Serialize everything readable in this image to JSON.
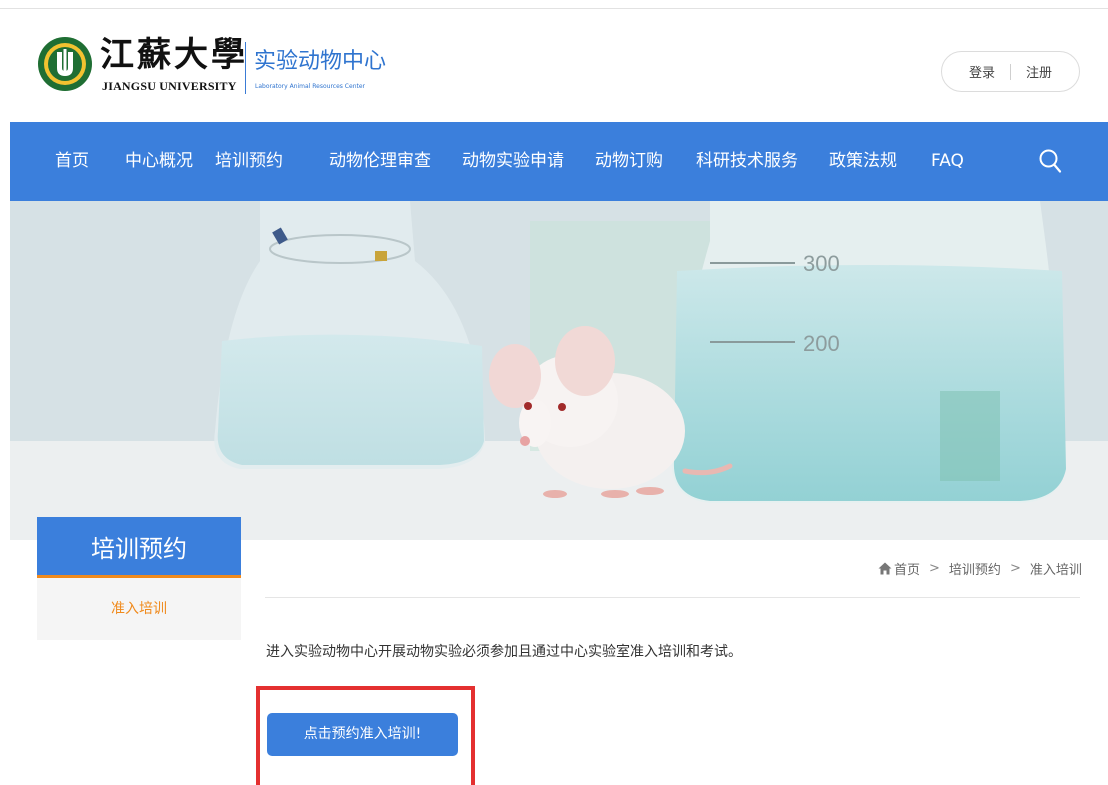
{
  "header": {
    "logo_cn": "江蘇大學",
    "logo_en": "JIANGSU UNIVERSITY",
    "center_cn": "实验动物中心",
    "center_en": "Laboratory Animal Resources Center",
    "login": "登录",
    "register": "注册"
  },
  "nav": {
    "items": [
      {
        "label": "首页"
      },
      {
        "label": "中心概况"
      },
      {
        "label": "培训预约"
      },
      {
        "label": "动物伦理审查"
      },
      {
        "label": "动物实验申请"
      },
      {
        "label": "动物订购"
      },
      {
        "label": "科研技术服务"
      },
      {
        "label": "政策法规"
      },
      {
        "label": "FAQ"
      }
    ],
    "search_icon": "search-icon"
  },
  "banner": {
    "flask_marks": [
      "300",
      "200"
    ]
  },
  "sidebar": {
    "title": "培训预约",
    "items": [
      {
        "label": "准入培训"
      }
    ]
  },
  "breadcrumb": {
    "home": "首页",
    "level1": "培训预约",
    "level2": "准入培训",
    "separator": ">"
  },
  "content": {
    "notice": "进入实验动物中心开展动物实验必须参加且通过中心实验室准入培训和考试。",
    "button": "点击预约准入培训!"
  },
  "colors": {
    "primary_blue": "#3b7fdc",
    "accent_orange": "#f08a1c",
    "highlight_red": "#e43030"
  }
}
